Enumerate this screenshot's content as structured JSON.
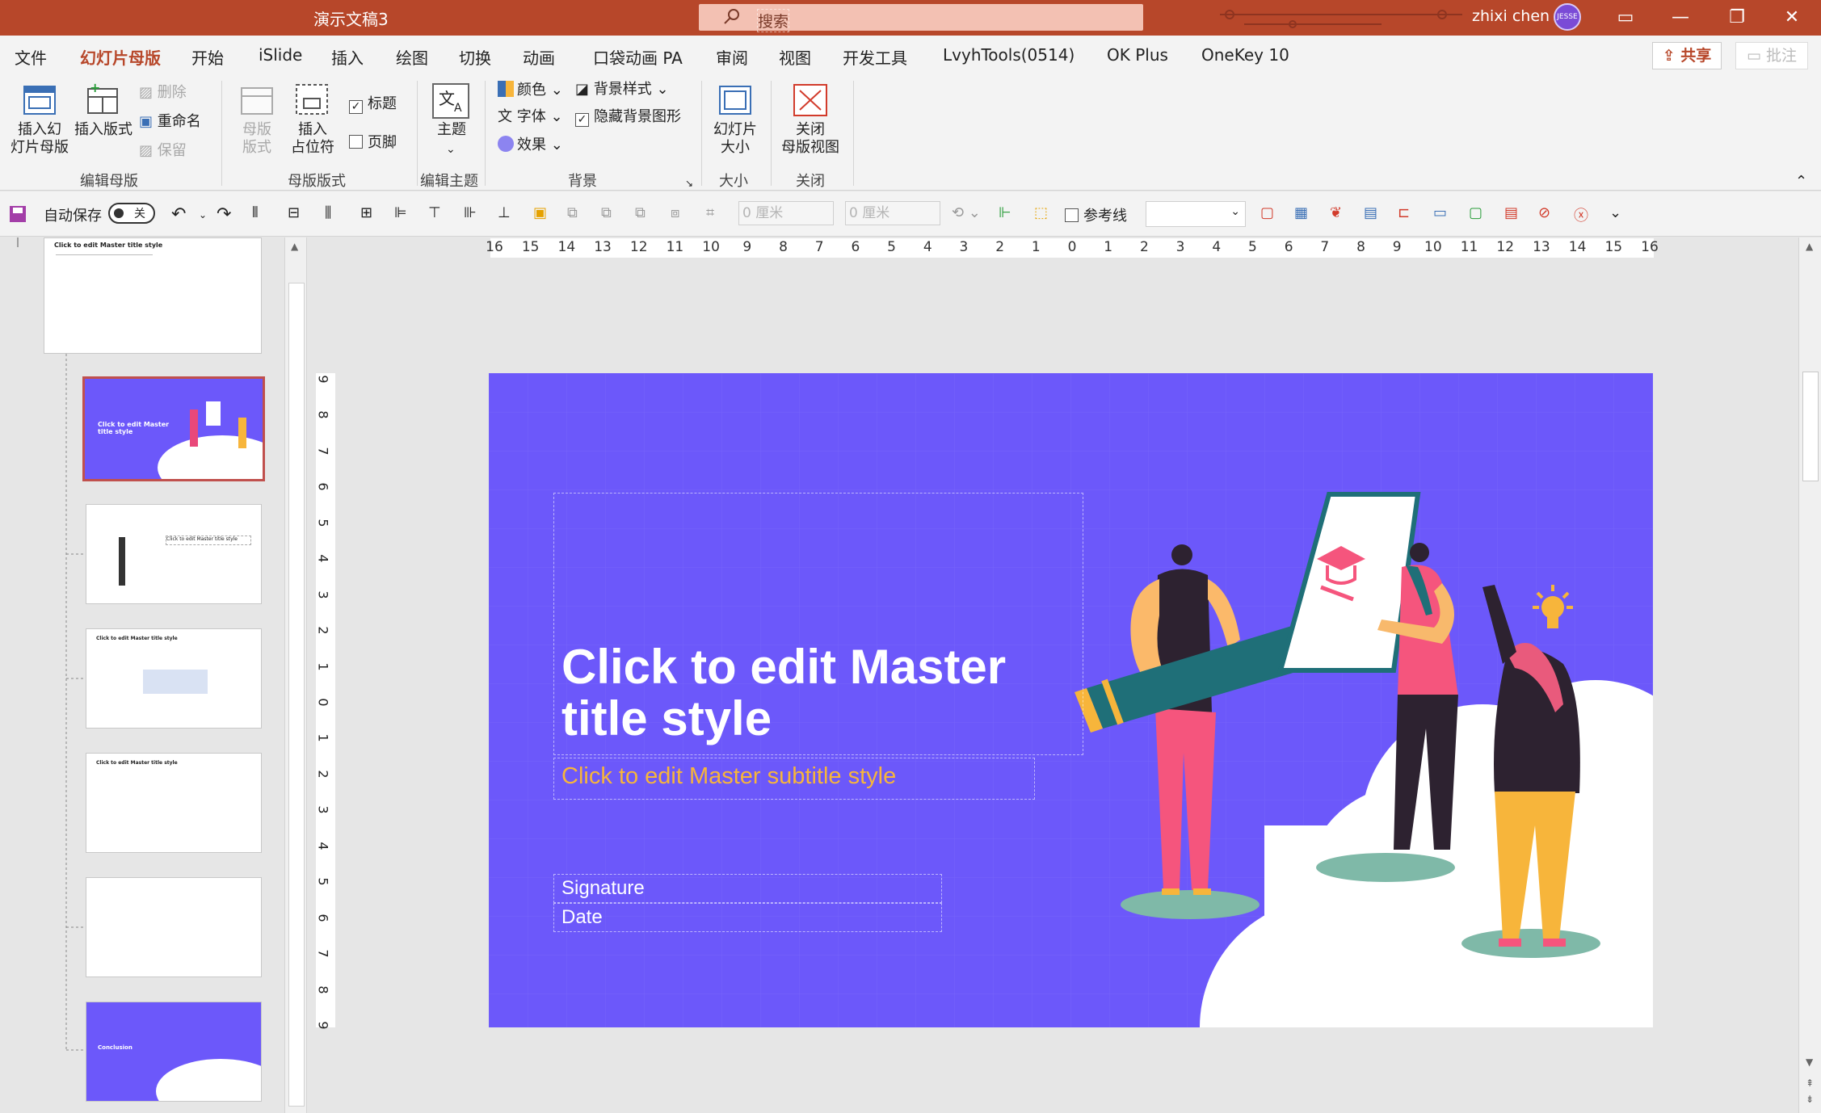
{
  "titlebar": {
    "doc_title": "演示文稿3",
    "search_placeholder": "搜索",
    "user_name": "zhixi chen",
    "avatar_text": "JESSE"
  },
  "menu": {
    "tabs": [
      "文件",
      "幻灯片母版",
      "开始",
      "iSlide",
      "插入",
      "绘图",
      "切换",
      "动画",
      "口袋动画 PA",
      "审阅",
      "视图",
      "开发工具",
      "LvyhTools(0514)",
      "OK Plus",
      "OneKey 10"
    ],
    "active_tab": "幻灯片母版",
    "share": "共享",
    "comment": "批注"
  },
  "ribbon": {
    "insert_master": "插入幻\n灯片母版",
    "insert_layout": "插入版式",
    "delete": "删除",
    "rename": "重命名",
    "preserve": "保留",
    "group_edit_master": "编辑母版",
    "master_layout": "母版\n版式",
    "insert_placeholder": "插入\n占位符",
    "title_check": "标题",
    "footer_check": "页脚",
    "group_master_layout": "母版版式",
    "theme": "主题",
    "group_edit_theme": "编辑主题",
    "colors": "颜色",
    "fonts": "字体",
    "effects": "效果",
    "bg_styles": "背景样式",
    "hide_bg": "隐藏背景图形",
    "group_background": "背景",
    "slide_size": "幻灯片\n大小",
    "group_size": "大小",
    "close_view": "关闭\n母版视图",
    "group_close": "关闭"
  },
  "qat": {
    "autosave": "自动保存",
    "autosave_state": "关",
    "width_value": "0 厘米",
    "height_value": "0 厘米",
    "guides": "参考线"
  },
  "slide": {
    "title": "Click to edit Master title style",
    "subtitle": "Click to edit Master subtitle style",
    "signature": "Signature",
    "date": "Date"
  },
  "thumbs": {
    "t1_title": "Click to edit Master title style",
    "t2_title": "Click to edit Master title style",
    "t3_title": "Click to edit Master title style",
    "t4_title": "Click to edit Master title style",
    "t5_title": "Click to edit Master title style",
    "t7_title": "Conclusion"
  },
  "ruler": {
    "h_ticks": [
      "16",
      "15",
      "14",
      "13",
      "12",
      "11",
      "10",
      "9",
      "8",
      "7",
      "6",
      "5",
      "4",
      "3",
      "2",
      "1",
      "0",
      "1",
      "2",
      "3",
      "4",
      "5",
      "6",
      "7",
      "8",
      "9",
      "10",
      "11",
      "12",
      "13",
      "14",
      "15",
      "16"
    ],
    "v_ticks": [
      "9",
      "8",
      "7",
      "6",
      "5",
      "4",
      "3",
      "2",
      "1",
      "0",
      "1",
      "2",
      "3",
      "4",
      "5",
      "6",
      "7",
      "8",
      "9"
    ]
  },
  "colors": {
    "brand": "#b7472a",
    "slide_bg": "#6c58fa",
    "subtitle": "#f7b53b"
  }
}
